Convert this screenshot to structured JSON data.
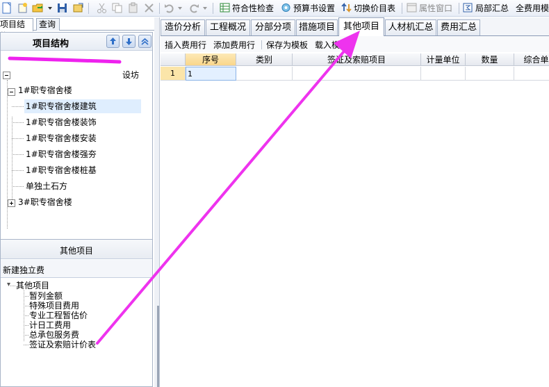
{
  "toolbar": {
    "compliance_check": "符合性检查",
    "budget_settings": "预算书设置",
    "switch_price_list": "切换价目表",
    "property_window": "属性窗口",
    "partial_summary": "局部汇总",
    "full_cost": "全费用模"
  },
  "left_tabs": [
    "项目结构",
    "查询"
  ],
  "structure": {
    "title": "项目结构",
    "root_label_visible": "设坊",
    "tree": [
      {
        "label": "1#职专宿舍楼",
        "expanded": true
      },
      {
        "label": "1#职专宿舍楼建筑",
        "selected": true
      },
      {
        "label": "1#职专宿舍楼装饰"
      },
      {
        "label": "1#职专宿舍楼安装"
      },
      {
        "label": "1#职专宿舍楼强夯"
      },
      {
        "label": "1#职专宿舍楼桩基"
      },
      {
        "label": "单独土石方"
      },
      {
        "label": "3#职专宿舍楼",
        "expanded": false
      }
    ]
  },
  "other": {
    "title": "其他项目",
    "new_fee": "新建独立费",
    "root": "其他项目",
    "items": [
      "暂列金额",
      "特殊项目费用",
      "专业工程暂估价",
      "计日工费用",
      "总承包服务费",
      "签证及索赔计价表"
    ]
  },
  "main_tabs": [
    "造价分析",
    "工程概况",
    "分部分项",
    "措施项目",
    "其他项目",
    "人材机汇总",
    "费用汇总"
  ],
  "active_tab": "其他项目",
  "sub_toolbar": [
    "插入费用行",
    "添加费用行",
    "保存为模板",
    "载入模板"
  ],
  "grid": {
    "columns": [
      "序号",
      "类别",
      "签证及索赔项目",
      "计量单位",
      "数量",
      "综合单价"
    ],
    "rows": [
      {
        "row_no": "1",
        "seq": "1"
      }
    ]
  },
  "colors": {
    "annotation": "#ee33ee",
    "redaction": "#ee22ee",
    "row_header": "#fbe5a9",
    "selection": "#dfeefe"
  }
}
